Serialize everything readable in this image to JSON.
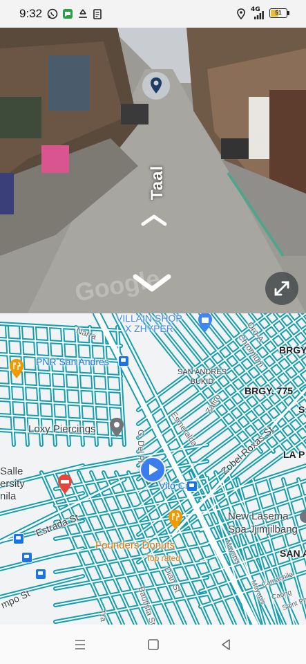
{
  "status_bar": {
    "time": "9:32",
    "network": "4G",
    "battery": "51",
    "battery_level": 0.51,
    "icons": [
      "whatsapp-icon",
      "messages-icon",
      "recycle-icon",
      "clipboard-icon",
      "location-icon",
      "signal-icon"
    ]
  },
  "street_view": {
    "street_name": "Taal",
    "watermark": "Google",
    "icons": [
      "location-pin-icon",
      "chevron-up-icon",
      "chevron-down-icon",
      "expand-icon"
    ]
  },
  "map": {
    "places": {
      "villain_shop": "VILLAIN SHOP\nX ZHYPER",
      "pnr": "PNR San Andres",
      "san_andres_bukid": "SAN ANDRES\nBUKID",
      "brgy_775": "BRGY. 775",
      "brgy_edge": "BRGY",
      "loxy": "Loxy Piercings",
      "salle": "Salle\nersity\nnila",
      "vito_cruz": "Vito Cruz",
      "new_lasema": "New Lasema\nSpa Jjimjilbang",
      "founders": "Founders Donuts",
      "top_rated": "Top rated",
      "la_p": "LA P",
      "san_a": "SAN A",
      "s_edge": "S"
    },
    "streets": {
      "narra": "Narra",
      "oro_a": "Oro-A",
      "chromium": "Chromium",
      "zafiro": "Zafiro",
      "esmeralda": "Esmeralda",
      "g_del_pi": "G. Del Pi",
      "zobel_roxas": "Zobel Roxas St",
      "estrada": "Estrada St",
      "mayapis_1": "Mayapis",
      "mayapis_2": "Mayapis",
      "camachile": "Camachile",
      "caong": "Caong",
      "saint_pa": "Saint Pa",
      "dian": "Dian St",
      "bautista": "Bautista St",
      "campo": "mpo St",
      "tra": "Tra"
    },
    "colors": {
      "road": "#129eaf",
      "poi_shop": "#4285f4",
      "poi_food": "#f29900",
      "poi_hotel": "#e8453c",
      "poi_generic": "#70757a",
      "transit": "#1a73e8",
      "location": "#3b7ded"
    }
  },
  "nav_bar": {
    "icons": [
      "menu-icon",
      "home-icon",
      "back-icon"
    ]
  }
}
